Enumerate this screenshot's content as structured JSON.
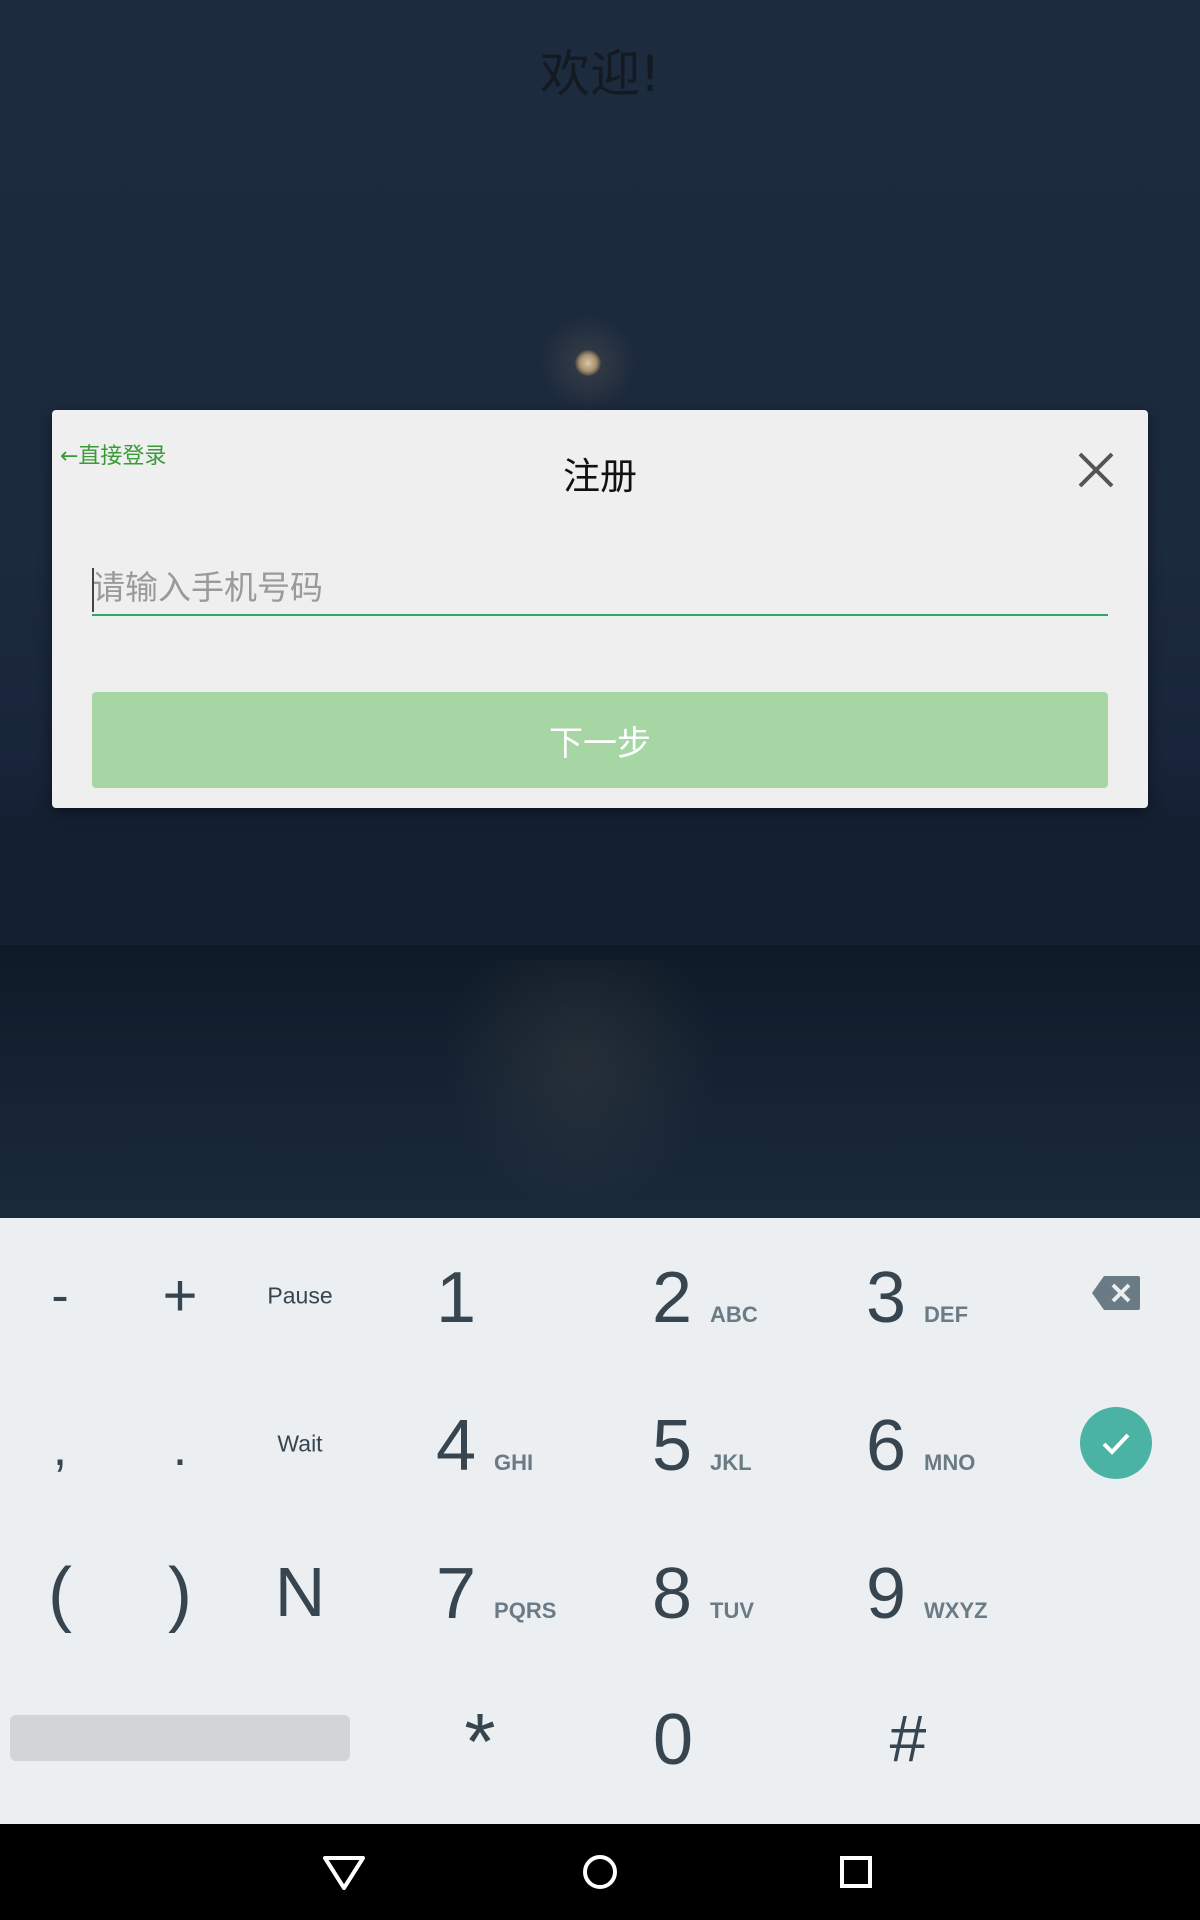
{
  "app": {
    "welcome_text": "欢迎!"
  },
  "dialog": {
    "back_label": "←直接登录",
    "title": "注册",
    "close_icon": "close-icon",
    "phone_placeholder": "请输入手机号码",
    "phone_value": "",
    "next_label": "下一步"
  },
  "keypad": {
    "left_keys": {
      "minus": "-",
      "plus": "+",
      "pause": "Pause",
      "comma": ",",
      "period": ".",
      "wait": "Wait",
      "paren_open": "(",
      "paren_close": ")",
      "n": "N"
    },
    "digits": [
      {
        "digit": "1",
        "letters": ""
      },
      {
        "digit": "2",
        "letters": "ABC"
      },
      {
        "digit": "3",
        "letters": "DEF"
      },
      {
        "digit": "4",
        "letters": "GHI"
      },
      {
        "digit": "5",
        "letters": "JKL"
      },
      {
        "digit": "6",
        "letters": "MNO"
      },
      {
        "digit": "7",
        "letters": "PQRS"
      },
      {
        "digit": "8",
        "letters": "TUV"
      },
      {
        "digit": "9",
        "letters": "WXYZ"
      }
    ],
    "bottom_row": {
      "star": "*",
      "zero": "0",
      "hash": "#"
    },
    "backspace_icon": "backspace-icon",
    "enter_icon": "check-icon"
  },
  "navbar": {
    "back_icon": "triangle-back-icon",
    "home_icon": "circle-home-icon",
    "recents_icon": "square-recents-icon"
  },
  "colors": {
    "accent_green": "#2bab61",
    "button_green": "#a5d6a4",
    "link_green": "#3a9a3a",
    "enter_teal": "#4bb3a4"
  }
}
